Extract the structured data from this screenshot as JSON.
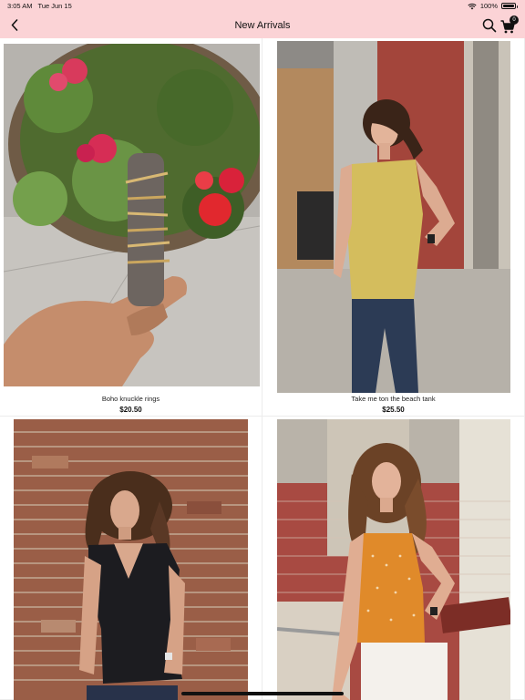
{
  "status_bar": {
    "time": "3:05 AM",
    "date": "Tue Jun 15",
    "battery": "100%",
    "icons": [
      "wifi-icon",
      "battery-icon"
    ]
  },
  "nav": {
    "title": "New Arrivals",
    "cart_count": "0",
    "icons": [
      "back-chevron-icon",
      "search-icon",
      "cart-icon"
    ]
  },
  "colors": {
    "bar": "#fbd3d6",
    "text": "#111111"
  },
  "products": [
    {
      "name": "Boho knuckle rings",
      "price": "$20.50"
    },
    {
      "name": "Take me ton the beach tank",
      "price": "$25.50"
    },
    {
      "name": "",
      "price": ""
    },
    {
      "name": "",
      "price": ""
    }
  ]
}
